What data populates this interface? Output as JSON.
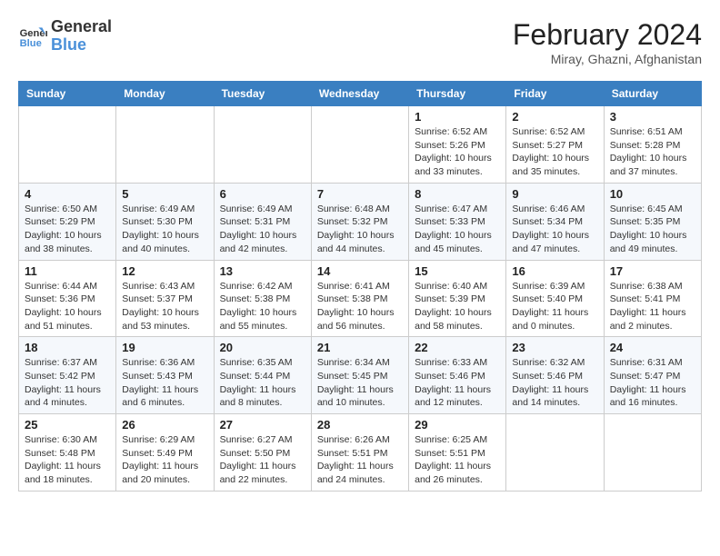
{
  "logo": {
    "text_general": "General",
    "text_blue": "Blue"
  },
  "title": "February 2024",
  "location": "Miray, Ghazni, Afghanistan",
  "days_of_week": [
    "Sunday",
    "Monday",
    "Tuesday",
    "Wednesday",
    "Thursday",
    "Friday",
    "Saturday"
  ],
  "weeks": [
    [
      {
        "day": "",
        "info": ""
      },
      {
        "day": "",
        "info": ""
      },
      {
        "day": "",
        "info": ""
      },
      {
        "day": "",
        "info": ""
      },
      {
        "day": "1",
        "info": "Sunrise: 6:52 AM\nSunset: 5:26 PM\nDaylight: 10 hours and 33 minutes."
      },
      {
        "day": "2",
        "info": "Sunrise: 6:52 AM\nSunset: 5:27 PM\nDaylight: 10 hours and 35 minutes."
      },
      {
        "day": "3",
        "info": "Sunrise: 6:51 AM\nSunset: 5:28 PM\nDaylight: 10 hours and 37 minutes."
      }
    ],
    [
      {
        "day": "4",
        "info": "Sunrise: 6:50 AM\nSunset: 5:29 PM\nDaylight: 10 hours and 38 minutes."
      },
      {
        "day": "5",
        "info": "Sunrise: 6:49 AM\nSunset: 5:30 PM\nDaylight: 10 hours and 40 minutes."
      },
      {
        "day": "6",
        "info": "Sunrise: 6:49 AM\nSunset: 5:31 PM\nDaylight: 10 hours and 42 minutes."
      },
      {
        "day": "7",
        "info": "Sunrise: 6:48 AM\nSunset: 5:32 PM\nDaylight: 10 hours and 44 minutes."
      },
      {
        "day": "8",
        "info": "Sunrise: 6:47 AM\nSunset: 5:33 PM\nDaylight: 10 hours and 45 minutes."
      },
      {
        "day": "9",
        "info": "Sunrise: 6:46 AM\nSunset: 5:34 PM\nDaylight: 10 hours and 47 minutes."
      },
      {
        "day": "10",
        "info": "Sunrise: 6:45 AM\nSunset: 5:35 PM\nDaylight: 10 hours and 49 minutes."
      }
    ],
    [
      {
        "day": "11",
        "info": "Sunrise: 6:44 AM\nSunset: 5:36 PM\nDaylight: 10 hours and 51 minutes."
      },
      {
        "day": "12",
        "info": "Sunrise: 6:43 AM\nSunset: 5:37 PM\nDaylight: 10 hours and 53 minutes."
      },
      {
        "day": "13",
        "info": "Sunrise: 6:42 AM\nSunset: 5:38 PM\nDaylight: 10 hours and 55 minutes."
      },
      {
        "day": "14",
        "info": "Sunrise: 6:41 AM\nSunset: 5:38 PM\nDaylight: 10 hours and 56 minutes."
      },
      {
        "day": "15",
        "info": "Sunrise: 6:40 AM\nSunset: 5:39 PM\nDaylight: 10 hours and 58 minutes."
      },
      {
        "day": "16",
        "info": "Sunrise: 6:39 AM\nSunset: 5:40 PM\nDaylight: 11 hours and 0 minutes."
      },
      {
        "day": "17",
        "info": "Sunrise: 6:38 AM\nSunset: 5:41 PM\nDaylight: 11 hours and 2 minutes."
      }
    ],
    [
      {
        "day": "18",
        "info": "Sunrise: 6:37 AM\nSunset: 5:42 PM\nDaylight: 11 hours and 4 minutes."
      },
      {
        "day": "19",
        "info": "Sunrise: 6:36 AM\nSunset: 5:43 PM\nDaylight: 11 hours and 6 minutes."
      },
      {
        "day": "20",
        "info": "Sunrise: 6:35 AM\nSunset: 5:44 PM\nDaylight: 11 hours and 8 minutes."
      },
      {
        "day": "21",
        "info": "Sunrise: 6:34 AM\nSunset: 5:45 PM\nDaylight: 11 hours and 10 minutes."
      },
      {
        "day": "22",
        "info": "Sunrise: 6:33 AM\nSunset: 5:46 PM\nDaylight: 11 hours and 12 minutes."
      },
      {
        "day": "23",
        "info": "Sunrise: 6:32 AM\nSunset: 5:46 PM\nDaylight: 11 hours and 14 minutes."
      },
      {
        "day": "24",
        "info": "Sunrise: 6:31 AM\nSunset: 5:47 PM\nDaylight: 11 hours and 16 minutes."
      }
    ],
    [
      {
        "day": "25",
        "info": "Sunrise: 6:30 AM\nSunset: 5:48 PM\nDaylight: 11 hours and 18 minutes."
      },
      {
        "day": "26",
        "info": "Sunrise: 6:29 AM\nSunset: 5:49 PM\nDaylight: 11 hours and 20 minutes."
      },
      {
        "day": "27",
        "info": "Sunrise: 6:27 AM\nSunset: 5:50 PM\nDaylight: 11 hours and 22 minutes."
      },
      {
        "day": "28",
        "info": "Sunrise: 6:26 AM\nSunset: 5:51 PM\nDaylight: 11 hours and 24 minutes."
      },
      {
        "day": "29",
        "info": "Sunrise: 6:25 AM\nSunset: 5:51 PM\nDaylight: 11 hours and 26 minutes."
      },
      {
        "day": "",
        "info": ""
      },
      {
        "day": "",
        "info": ""
      }
    ]
  ]
}
